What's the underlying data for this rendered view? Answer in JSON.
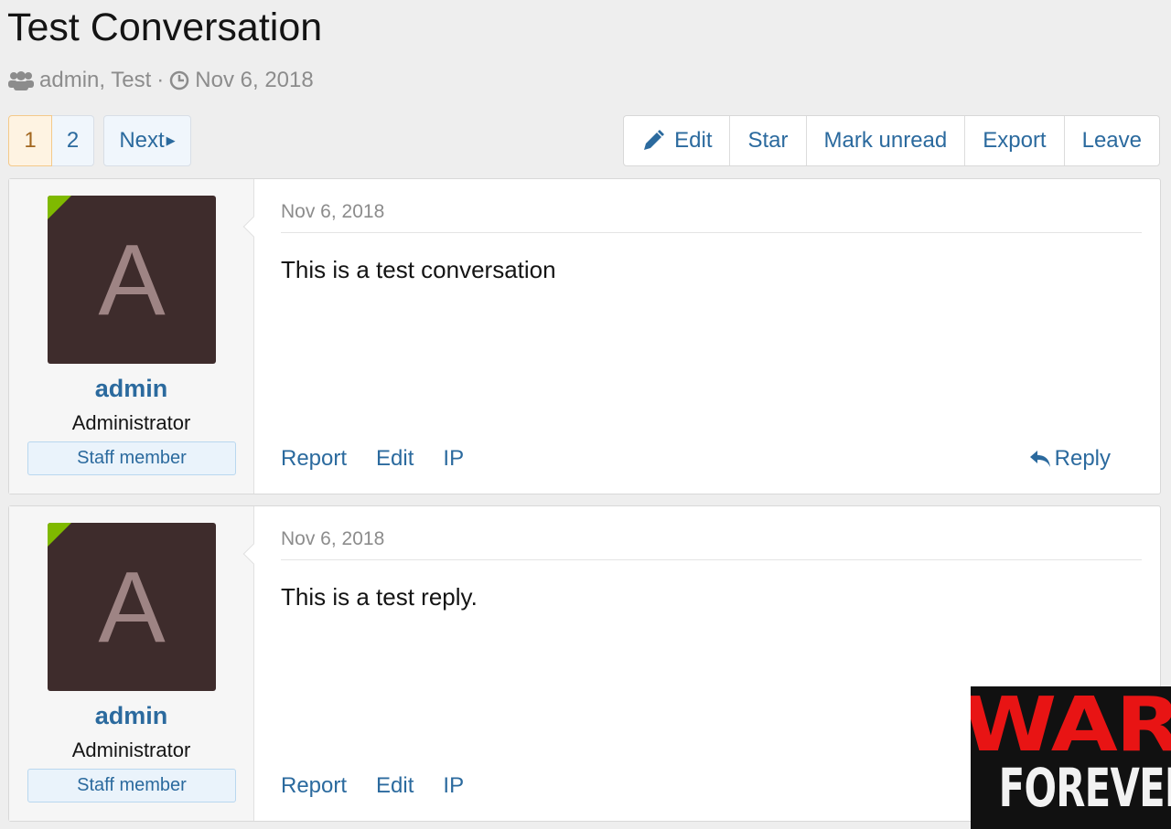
{
  "title": "Test Conversation",
  "meta": {
    "participants": "admin, Test",
    "separator": "·",
    "date": "Nov 6, 2018"
  },
  "pagination": {
    "pages": [
      "1",
      "2"
    ],
    "current": "1",
    "next": "Next"
  },
  "actions": [
    "Edit",
    "Star",
    "Mark unread",
    "Export",
    "Leave"
  ],
  "messages": [
    {
      "avatar_letter": "A",
      "username": "admin",
      "user_title": "Administrator",
      "badge": "Staff member",
      "date": "Nov 6, 2018",
      "text": "This is a test conversation",
      "links": [
        "Report",
        "Edit",
        "IP"
      ],
      "reply": "Reply"
    },
    {
      "avatar_letter": "A",
      "username": "admin",
      "user_title": "Administrator",
      "badge": "Staff member",
      "date": "Nov 6, 2018",
      "text": "This is a test reply.",
      "links": [
        "Report",
        "Edit",
        "IP"
      ]
    }
  ],
  "watermark": {
    "line1": "WAR",
    "line2": "FOREVER"
  },
  "colors": {
    "link": "#2b6a9e",
    "online": "#7fb900",
    "avatar_bg": "#3e2c2c"
  }
}
